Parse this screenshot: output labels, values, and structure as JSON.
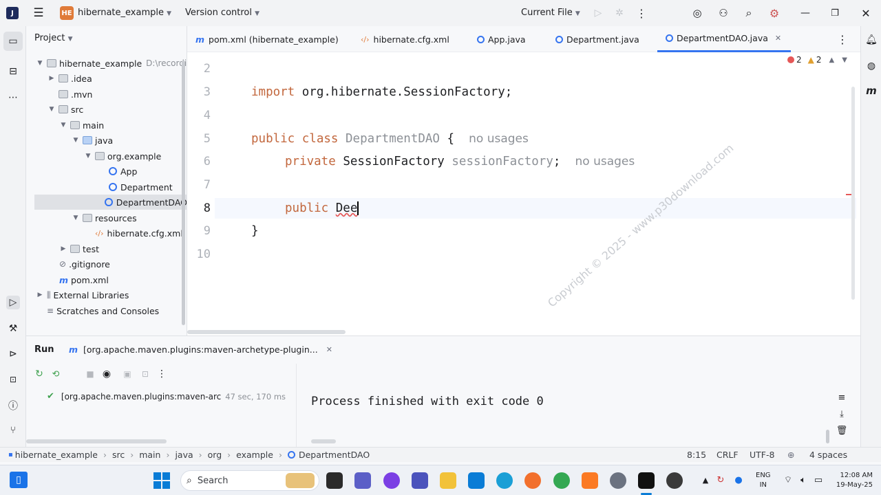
{
  "titlebar": {
    "project_badge": "HE",
    "project_name": "hibernate_example",
    "vcs_label": "Version control",
    "run_config": "Current File"
  },
  "project_panel": {
    "title": "Project",
    "root_name": "hibernate_example",
    "root_path": "D:\\recordi",
    "items": [
      {
        "label": "hibernate_example"
      },
      {
        "label": ".idea"
      },
      {
        "label": ".mvn"
      },
      {
        "label": "src"
      },
      {
        "label": "main"
      },
      {
        "label": "java"
      },
      {
        "label": "org.example"
      },
      {
        "label": "App"
      },
      {
        "label": "Department"
      },
      {
        "label": "DepartmentDAO"
      },
      {
        "label": "resources"
      },
      {
        "label": "hibernate.cfg.xml"
      },
      {
        "label": "test"
      },
      {
        "label": ".gitignore"
      },
      {
        "label": "pom.xml"
      },
      {
        "label": "External Libraries"
      },
      {
        "label": "Scratches and Consoles"
      }
    ]
  },
  "editor_tabs": [
    {
      "label": "pom.xml (hibernate_example)"
    },
    {
      "label": "hibernate.cfg.xml"
    },
    {
      "label": "App.java"
    },
    {
      "label": "Department.java"
    },
    {
      "label": "DepartmentDAO.java"
    }
  ],
  "inspections": {
    "errors": "2",
    "warnings": "2"
  },
  "code": {
    "line_numbers": [
      "2",
      "3",
      "4",
      "5",
      "6",
      "7",
      "8",
      "9",
      "10"
    ],
    "import_kw": "import",
    "import_path": "org.hibernate.SessionFactory;",
    "public_kw": "public",
    "class_kw": "class",
    "class_name": "DepartmentDAO",
    "open_brace": "{",
    "no_usages": "no usages",
    "private_kw": "private",
    "field_type": "SessionFactory",
    "field_name": "sessionFactory",
    "semicolon": ";",
    "typed": "Dee",
    "close_brace": "}"
  },
  "watermark": "Copyright © 2025 - www.p30download.com",
  "run_panel": {
    "tab_label": "Run",
    "run_tab_title": "[org.apache.maven.plugins:maven-archetype-plugin...",
    "tree_item": "[org.apache.maven.plugins:maven-arc",
    "tree_time": "47 sec, 170 ms",
    "console_output": "Process finished with exit code 0"
  },
  "status_bar": {
    "breadcrumbs": [
      "hibernate_example",
      "src",
      "main",
      "java",
      "org",
      "example",
      "DepartmentDAO"
    ],
    "position": "8:15",
    "line_sep": "CRLF",
    "encoding": "UTF-8",
    "indent": "4 spaces"
  },
  "taskbar": {
    "search_placeholder": "Search",
    "lang": "ENG",
    "region": "IN",
    "time": "12:08 AM",
    "date": "19-May-25"
  },
  "colors": {
    "accent": "#3574f0",
    "keyword": "#c2673d",
    "error": "#e55757"
  }
}
